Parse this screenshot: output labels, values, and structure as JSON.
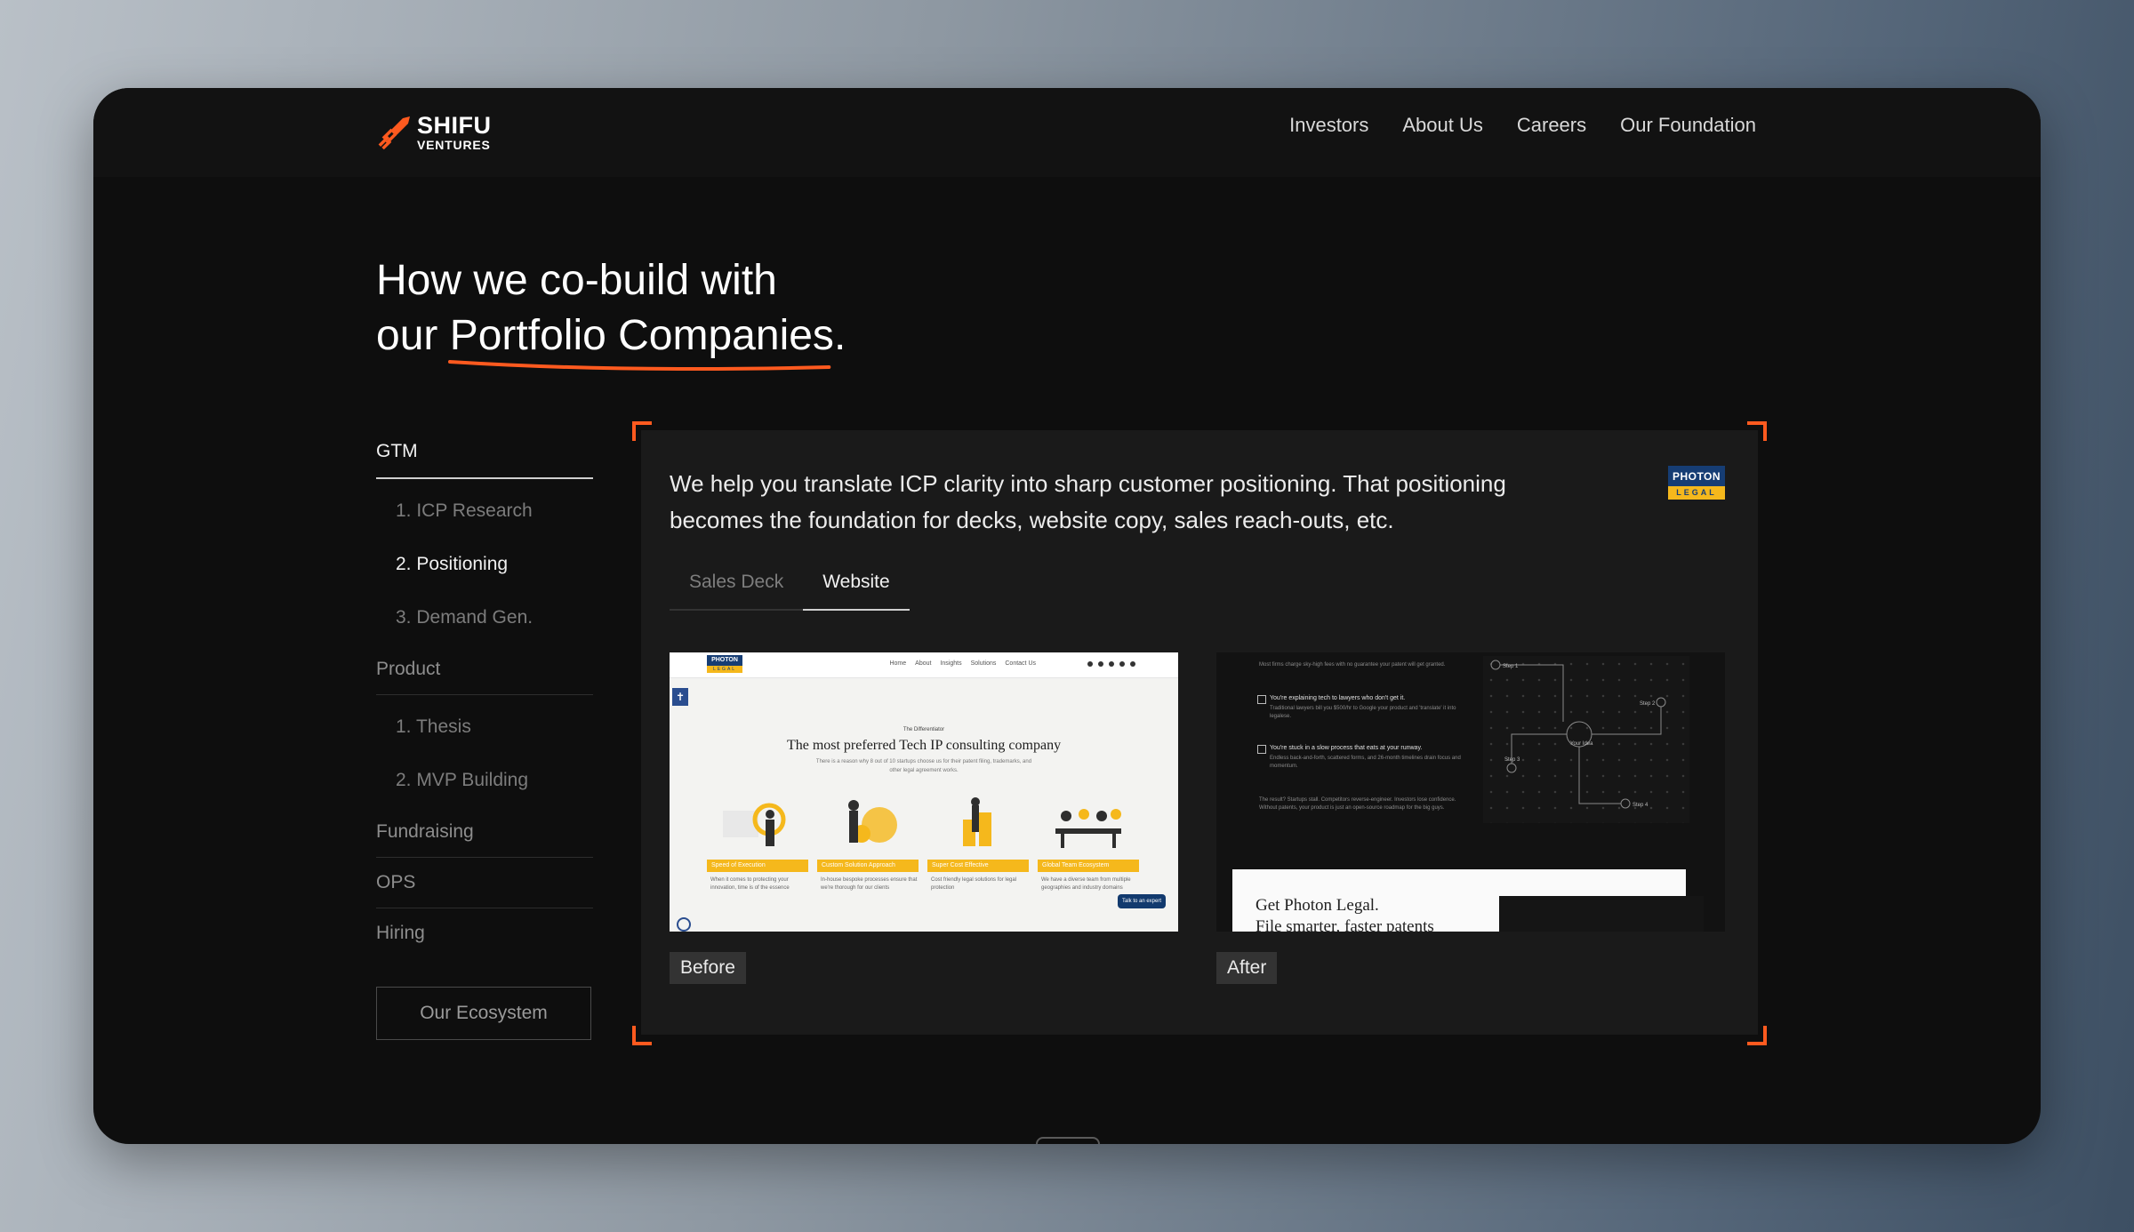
{
  "brand": {
    "name_line1": "SHIFU",
    "name_line2": "VENTURES",
    "accent": "#ff5a1f"
  },
  "nav": {
    "links": [
      "Investors",
      "About Us",
      "Careers",
      "Our Foundation"
    ]
  },
  "heading": {
    "line1": "How we co-build with",
    "line2_prefix": "our ",
    "highlight": "Portfolio Companies",
    "suffix": "."
  },
  "sidebar": {
    "gtm": "GTM",
    "gtm_items": [
      "1. ICP Research",
      "2. Positioning",
      "3. Demand Gen."
    ],
    "product": "Product",
    "product_items": [
      "1. Thesis",
      "2. MVP Building"
    ],
    "fundraising": "Fundraising",
    "ops": "OPS",
    "hiring": "Hiring",
    "active_item": "2. Positioning"
  },
  "ecosystem_button": "Our Ecosystem",
  "panel": {
    "description": "We help you translate ICP clarity into sharp customer positioning. That positioning becomes the foundation for decks, website copy, sales reach-outs, etc.",
    "badge_top": "PHOTON",
    "badge_bottom": "LEGAL",
    "tabs": [
      "Sales Deck",
      "Website"
    ],
    "active_tab": "Website",
    "before_label": "Before",
    "after_label": "After"
  },
  "before_site": {
    "logo_top": "PHOTON",
    "logo_bottom": "LEGAL",
    "nav": [
      "Home",
      "About",
      "Insights",
      "Solutions",
      "Contact Us"
    ],
    "eyebrow": "The Differentiator",
    "title": "The most preferred Tech IP consulting company",
    "line1": "There is a reason why 8 out of 10 startups choose us for their patent filing, trademarks, and",
    "line2": "other legal agreement works.",
    "cards": [
      {
        "tag": "Speed of Execution",
        "text": "When it comes to protecting your innovation, time is of the essence"
      },
      {
        "tag": "Custom Solution Approach",
        "text": "In-house bespoke processes ensure that we're thorough for our clients"
      },
      {
        "tag": "Super Cost Effective",
        "text": "Cost friendly legal solutions for legal protection"
      },
      {
        "tag": "Global Team Ecosystem",
        "text": "We have a diverse team from multiple geographies and industry domains"
      }
    ],
    "chat": "Talk to an expert"
  },
  "after_site": {
    "row1": "Most firms charge sky-high fees with no guarantee your patent will get granted.",
    "row2": "You're explaining tech to lawyers who don't get it.",
    "row2_sub": "Traditional lawyers bill you $500/hr to Google your product and 'translate' it into legalese.",
    "row3": "You're stuck in a slow process that eats at your runway.",
    "row3_sub": "Endless back-and-forth, scattered forms, and 26-month timelines drain focus and momentum.",
    "row4": "The result? Startups stall. Competitors reverse-engineer. Investors lose confidence. Without patents, your product is just an open-source roadmap for the big guys.",
    "cta_line1": "Get Photon Legal.",
    "cta_line2": "File smarter, faster patents",
    "grid_labels": [
      "Step 1",
      "Step 2",
      "Your Idea",
      "Step 3",
      "Step 4"
    ]
  }
}
